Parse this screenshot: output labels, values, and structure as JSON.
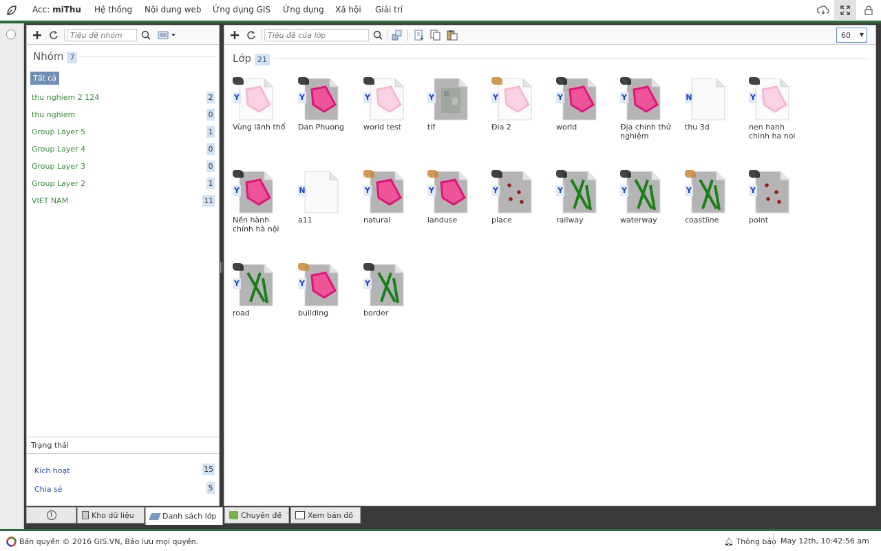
{
  "topbar": {
    "acc_label": "Acc:",
    "acc_user": "miThu",
    "menu": [
      "Hệ thống",
      "Nội dung web",
      "Ứng dụng GIS",
      "Ứng dụng",
      "Xã hội",
      "Giải trí"
    ]
  },
  "left": {
    "search_placeholder": "Tiêu đề nhóm",
    "title": "Nhóm",
    "count": "7",
    "all_label": "Tất cả",
    "groups": [
      {
        "name": "thu nghiem 2 124",
        "count": "2"
      },
      {
        "name": "thu nghiem",
        "count": "0"
      },
      {
        "name": "Group Layer 5",
        "count": "1"
      },
      {
        "name": "Group Layer 4",
        "count": "0"
      },
      {
        "name": "Group Layer 3",
        "count": "0"
      },
      {
        "name": "Group Layer 2",
        "count": "1"
      },
      {
        "name": "VIET NAM",
        "count": "11"
      }
    ],
    "status_title": "Trạng thái",
    "status": [
      {
        "name": "Kích hoạt",
        "count": "15"
      },
      {
        "name": "Chia sẻ",
        "count": "5"
      }
    ]
  },
  "right": {
    "search_placeholder": "Tiêu đề của lớp",
    "title": "Lớp",
    "count": "21",
    "page_size": "60",
    "layers": [
      {
        "name": "Vùng lãnh thổ",
        "flag": "Y",
        "kind": "polygon-light",
        "badge": "world"
      },
      {
        "name": "Dan Phuong",
        "flag": "Y",
        "kind": "polygon",
        "badge": "world"
      },
      {
        "name": "world test",
        "flag": "Y",
        "kind": "polygon-light",
        "badge": "world"
      },
      {
        "name": "tif",
        "flag": "Y",
        "kind": "raster",
        "badge": "none"
      },
      {
        "name": "Đia 2",
        "flag": "Y",
        "kind": "polygon-light",
        "badge": "hand"
      },
      {
        "name": "world",
        "flag": "Y",
        "kind": "polygon",
        "badge": "world"
      },
      {
        "name": "Địa chính thử nghiệm",
        "flag": "Y",
        "kind": "polygon",
        "badge": "world"
      },
      {
        "name": "thu 3d",
        "flag": "N",
        "kind": "blank",
        "badge": "none"
      },
      {
        "name": "nen hanh chinh ha noi",
        "flag": "Y",
        "kind": "polygon-light",
        "badge": "world"
      },
      {
        "name": "Nền hành chính hà nội",
        "flag": "Y",
        "kind": "polygon",
        "badge": "world"
      },
      {
        "name": "a11",
        "flag": "N",
        "kind": "blank",
        "badge": "none"
      },
      {
        "name": "natural",
        "flag": "Y",
        "kind": "polygon",
        "badge": "hand"
      },
      {
        "name": "landuse",
        "flag": "Y",
        "kind": "polygon",
        "badge": "hand"
      },
      {
        "name": "place",
        "flag": "Y",
        "kind": "point",
        "badge": "world"
      },
      {
        "name": "railway",
        "flag": "Y",
        "kind": "line",
        "badge": "world"
      },
      {
        "name": "waterway",
        "flag": "Y",
        "kind": "line",
        "badge": "world"
      },
      {
        "name": "coastline",
        "flag": "Y",
        "kind": "line",
        "badge": "hand"
      },
      {
        "name": "point",
        "flag": "Y",
        "kind": "point",
        "badge": "world"
      },
      {
        "name": "road",
        "flag": "Y",
        "kind": "line",
        "badge": "world"
      },
      {
        "name": "building",
        "flag": "Y",
        "kind": "polygon",
        "badge": "hand"
      },
      {
        "name": "border",
        "flag": "Y",
        "kind": "line",
        "badge": "world"
      }
    ]
  },
  "tabs": [
    "Kho dữ liệu",
    "Danh sách lớp",
    "Chuyên đề",
    "Xem bản đồ"
  ],
  "footer": {
    "copyright": "Bản quyền © 2016 GIS.VN, Bảo lưu mọi quyền.",
    "notification": "Thông báo",
    "datetime": "May 12th, 10:42:56 am"
  }
}
